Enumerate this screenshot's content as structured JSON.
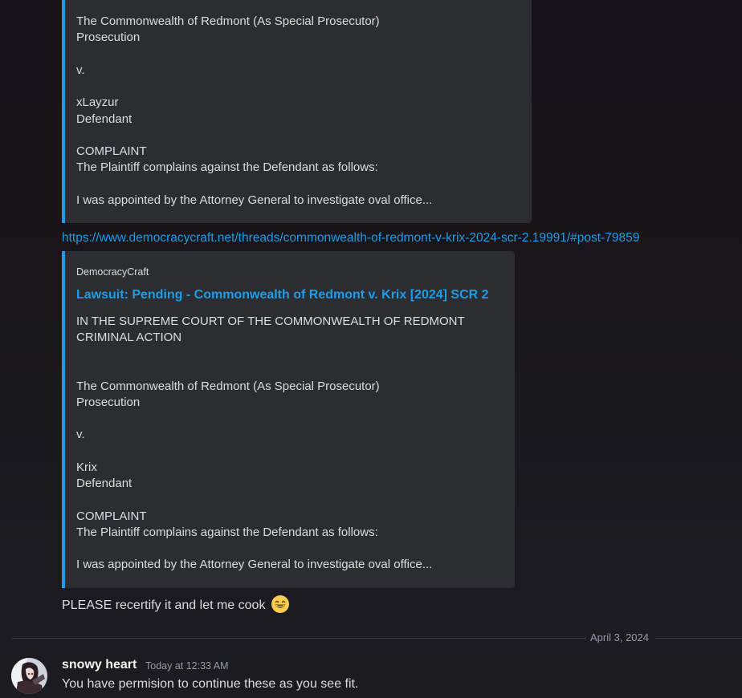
{
  "embed1": {
    "lines": [
      "The Commonwealth of Redmont (As Special Prosecutor)",
      "Prosecution",
      "v.",
      "xLayzur",
      "Defendant",
      "COMPLAINT",
      "The Plaintiff complains against the Defendant as follows:",
      "I was appointed by the Attorney General to investigate oval office..."
    ]
  },
  "link": {
    "url": "https://www.democracycraft.net/threads/commonwealth-of-redmont-v-krix-2024-scr-2.19991/#post-79859"
  },
  "embed2": {
    "provider": "DemocracyCraft",
    "title": "Lawsuit: Pending - Commonwealth of Redmont v. Krix [2024] SCR 2",
    "lines": [
      "IN THE SUPREME COURT OF THE COMMONWEALTH OF REDMONT",
      "CRIMINAL ACTION",
      "The Commonwealth of Redmont (As Special Prosecutor)",
      "Prosecution",
      "v.",
      "Krix",
      "Defendant",
      "COMPLAINT",
      "The Plaintiff complains against the Defendant as follows:",
      "I was appointed by the Attorney General to investigate oval office..."
    ]
  },
  "message1": {
    "text": "PLEASE recertify it and let me cook",
    "emoji": "grinning-smile-emoji"
  },
  "date_divider": {
    "label": "April 3, 2024"
  },
  "message2": {
    "username": "snowy heart",
    "timestamp": "Today at 12:33 AM",
    "text": "You have permision to continue these as you see fit."
  },
  "colors": {
    "link": "#1e9ce8",
    "embed_bg": "#2b2d31",
    "text": "#dbdee1",
    "muted": "#949ba4"
  }
}
